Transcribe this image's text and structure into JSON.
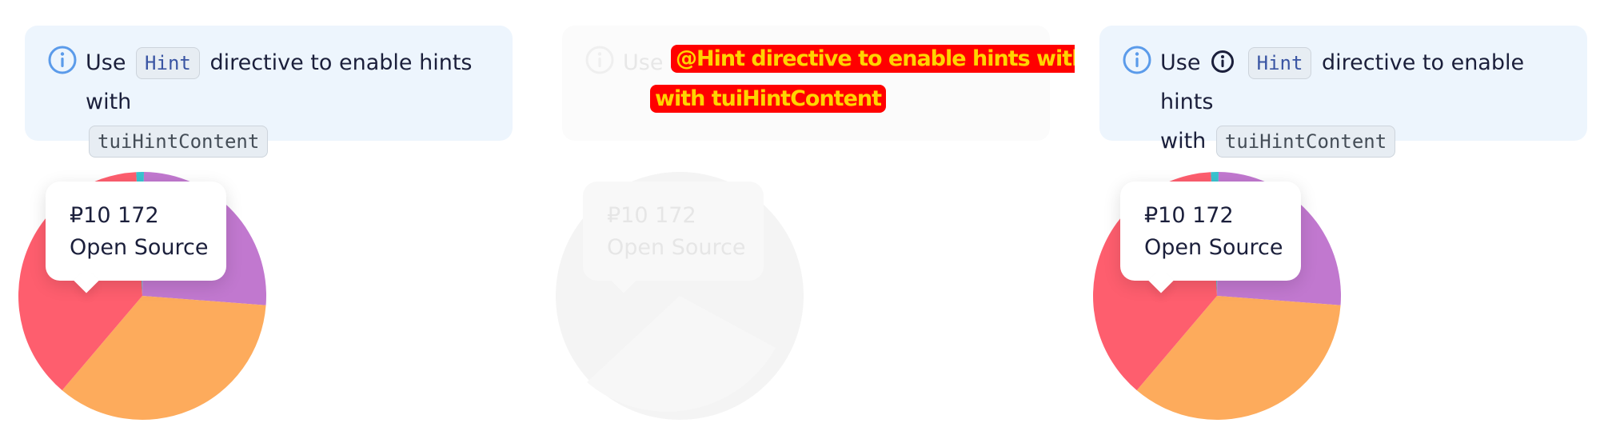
{
  "notice": {
    "use_word": "Use",
    "hint_code": "Hint",
    "directive_text": "directive to enable hints with",
    "directive_text_short": "directive to enable hints",
    "with_word": "with",
    "content_code": "tuiHintContent"
  },
  "tooltip": {
    "amount": "₽10 172",
    "label": "Open Source"
  },
  "glitch": {
    "line1": "@Hint directive to enable hints with",
    "line2": "with tuiHintContent"
  },
  "colors": {
    "notice_bg": "#edf5fd",
    "info_icon": "#5b9bea",
    "pie_red": "#fe5e6e",
    "pie_purple": "#c178cf",
    "pie_orange": "#fdab5c",
    "pie_teal": "#39c3cf"
  },
  "icons": [
    "info-circle-icon"
  ],
  "chart_data": {
    "type": "pie",
    "series": [
      {
        "values": [
          38,
          26,
          35,
          1
        ]
      }
    ],
    "categories": [
      "",
      "",
      "",
      "Open Source"
    ]
  }
}
